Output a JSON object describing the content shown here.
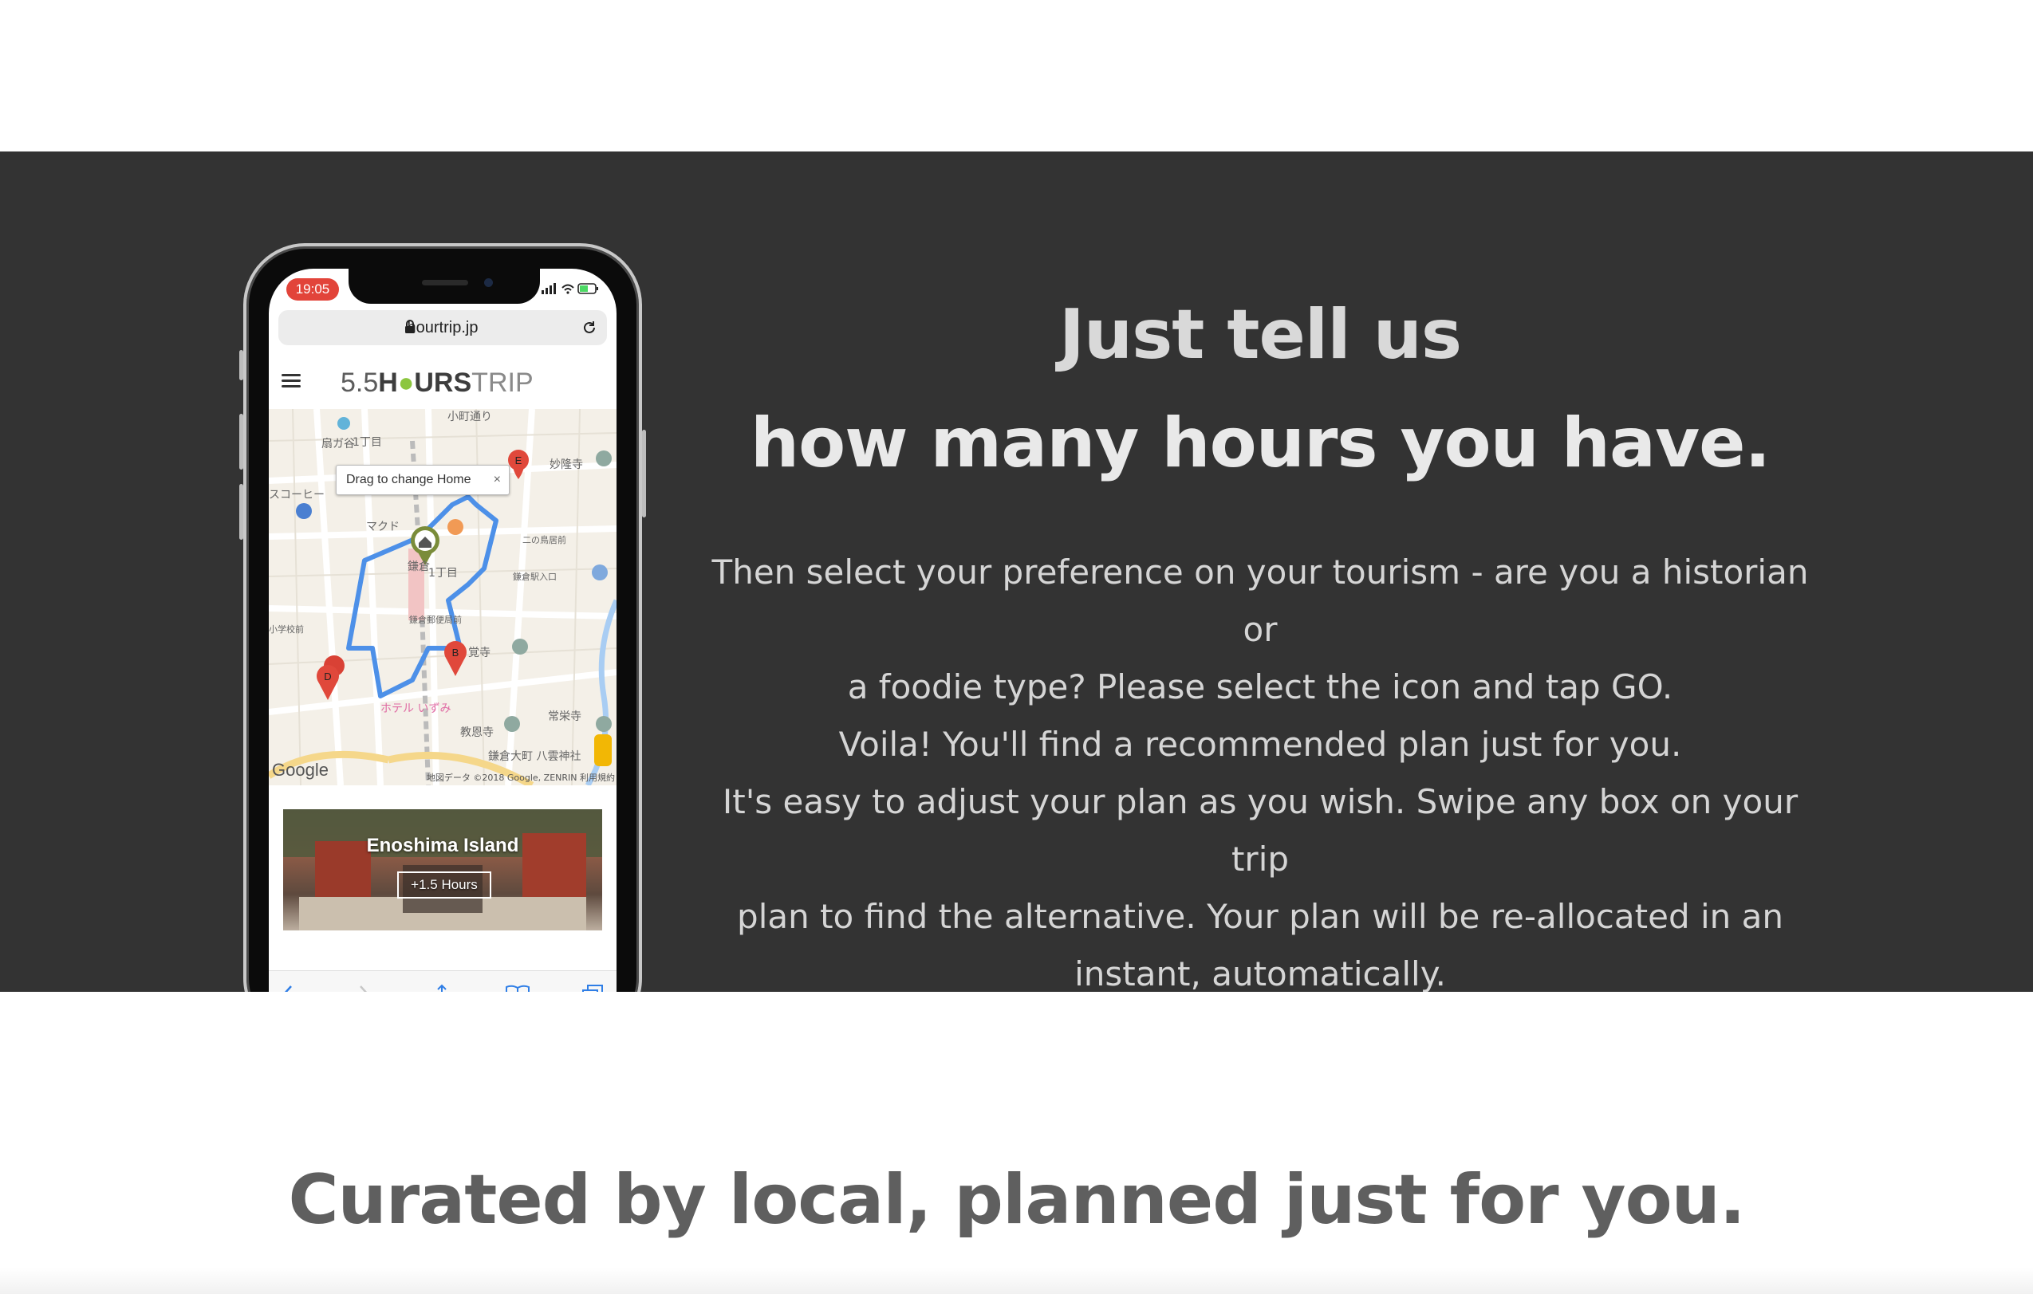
{
  "phone": {
    "status_time": "19:05",
    "url": "hourtrip.jp",
    "logo": {
      "part1": "5.5",
      "part2": "H",
      "part3": "URS",
      "part4": "TRIP"
    },
    "map": {
      "tooltip": "Drag to change Home",
      "tooltip_close": "×",
      "attribution": "Google",
      "copyright": "地図データ ©2018 Google, ZENRIN  利用規約"
    },
    "card": {
      "title": "Enoshima Island",
      "hours": "+1.5 Hours"
    }
  },
  "feature": {
    "headline_line1": "Just tell us",
    "headline_line2": "how many hours you have.",
    "body_lines": [
      "Then select your preference on your tourism - are you a historian or",
      "a foodie type? Please select the icon and tap GO.",
      "Voila! You'll find a recommended plan just for you.",
      "It's easy to adjust your plan as you wish. Swipe any box on your trip",
      "plan to find the alternative. Your plan will be re-allocated in an",
      "instant, automatically."
    ]
  },
  "tagline": "Curated by local, planned just for you."
}
